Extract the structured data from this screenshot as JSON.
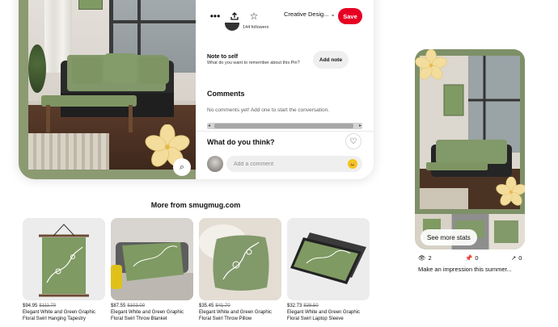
{
  "pin": {
    "toolbar": {
      "more_icon": "more-horizontal-icon",
      "share_icon": "share-upload-icon",
      "star_icon": "star-icon",
      "board_label": "Creative Desig...",
      "save_label": "Save"
    },
    "author": {
      "followers": "144 followers"
    },
    "note": {
      "title": "Note to self",
      "subtitle": "What do you want to remember about this Pin?",
      "add_label": "Add note"
    },
    "comments": {
      "title": "Comments",
      "empty_text": "No comments yet! Add one to start the conversation."
    },
    "feedback": {
      "title": "What do you think?",
      "placeholder": "Add a comment",
      "emoji": "😀"
    }
  },
  "more_from": {
    "title": "More from smugmug.com",
    "products": [
      {
        "price": "$94.95",
        "old_price": "$111.70",
        "name": "Elegant White and Green Graphic Floral Swirl Hanging Tapestry"
      },
      {
        "price": "$87.55",
        "old_price": "$103.00",
        "name": "Elegant White and Green Graphic Floral Swirl Throw Blanket"
      },
      {
        "price": "$35.45",
        "old_price": "$41.70",
        "name": "Elegant White and Green Graphic Floral Swirl Throw Pillow"
      },
      {
        "price": "$32.73",
        "old_price": "$38.50",
        "name": "Elegant White and Green Graphic Floral Swirl Laptop Sleeve"
      }
    ]
  },
  "side_pin": {
    "see_stats_label": "See more stats",
    "stats": [
      {
        "icon": "eye-icon",
        "value": "2"
      },
      {
        "icon": "pin-icon",
        "value": "0"
      },
      {
        "icon": "outbound-arrow-icon",
        "value": "0"
      }
    ],
    "impression_text": "Make an impression this summer..."
  },
  "colors": {
    "save_red": "#e60023",
    "sage_green": "#7e9567",
    "flower_yellow": "#f3dd9c"
  }
}
